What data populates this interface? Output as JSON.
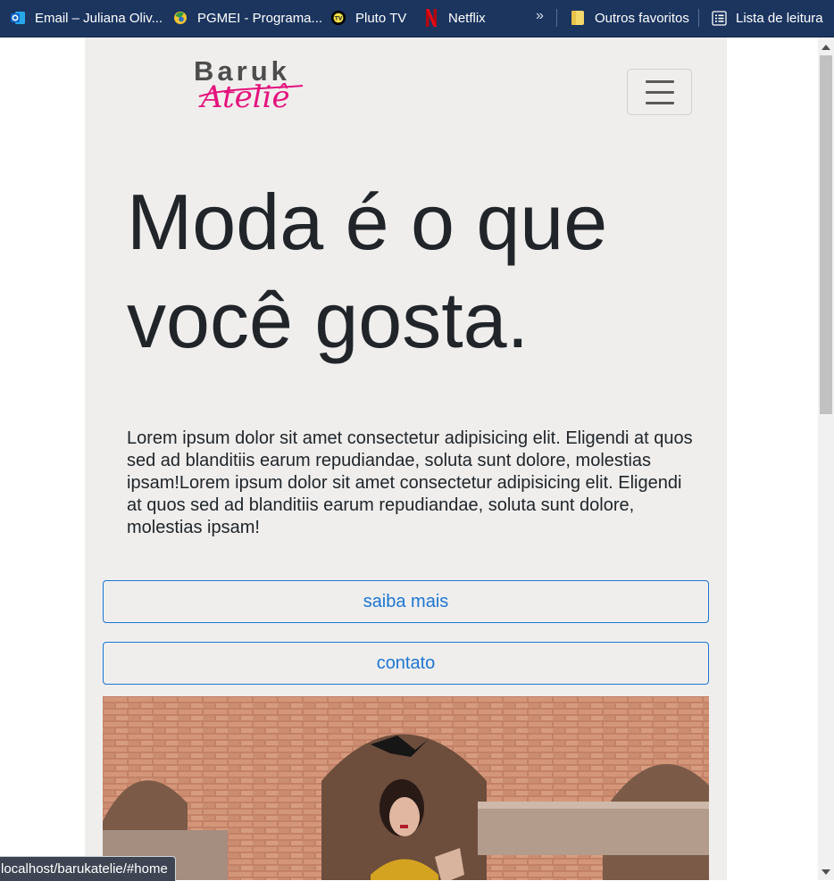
{
  "bookmarks": {
    "items": [
      {
        "label": "Email – Juliana Oliv...",
        "icon": "outlook-icon"
      },
      {
        "label": "PGMEI - Programa...",
        "icon": "pgmei-icon"
      },
      {
        "label": "Pluto TV",
        "icon": "pluto-tv-icon"
      },
      {
        "label": "Netflix",
        "icon": "netflix-icon"
      }
    ],
    "more_label": "»",
    "other_favorites": "Outros favoritos",
    "reading_list": "Lista de leitura"
  },
  "site": {
    "logo": {
      "top": "Baruk",
      "script": "Ateliê"
    },
    "hero": {
      "title": "Moda é o que você gosta.",
      "text": "Lorem ipsum dolor sit amet consectetur adipisicing elit. Eligendi at quos sed ad blanditiis earum repudiandae, soluta sunt dolore, molestias ipsam!Lorem ipsum dolor sit amet consectetur adipisicing elit. Eligendi at quos sed ad blanditiis earum repudiandae, soluta sunt dolore, molestias ipsam!"
    },
    "buttons": {
      "more": "saiba mais",
      "contact": "contato"
    }
  },
  "status_url": "localhost/barukatelie/#home",
  "colors": {
    "bookmark_bar": "#1b355f",
    "page_bg": "#efeeed",
    "accent_blue": "#1c76d2",
    "logo_pink": "#e5127d"
  }
}
